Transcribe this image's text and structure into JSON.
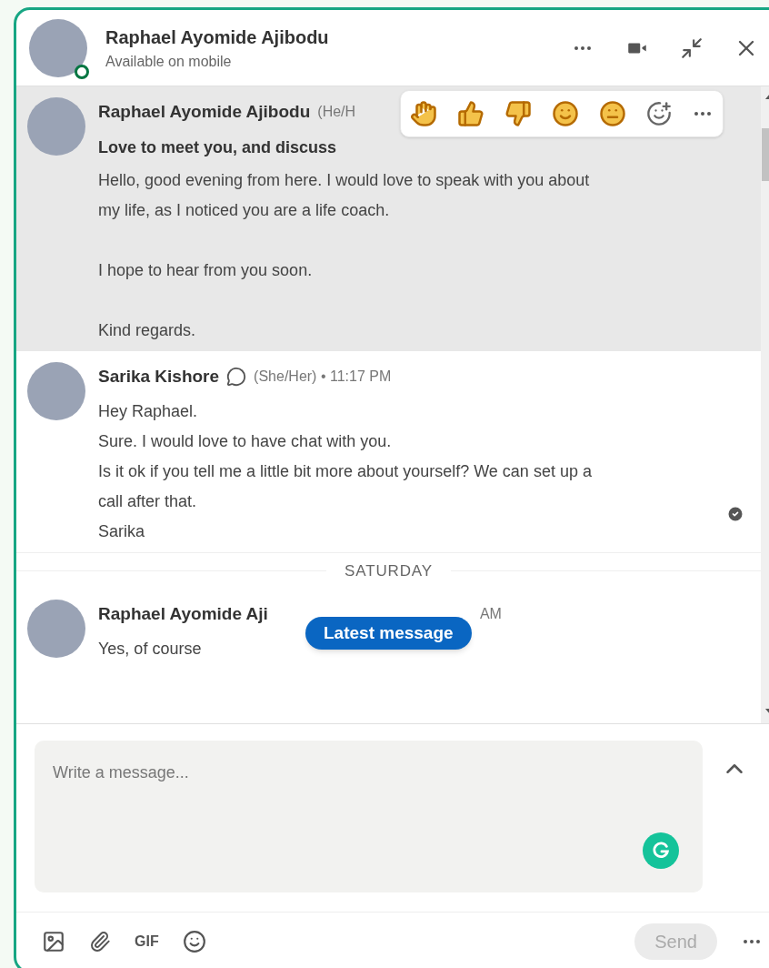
{
  "header": {
    "name": "Raphael Ayomide Ajibodu",
    "status": "Available on mobile",
    "online": true
  },
  "messages": [
    {
      "name": "Raphael Ayomide Ajibodu",
      "meta": "(He/H",
      "subject": "Love to meet you, and discuss",
      "paragraphs": [
        "Hello, good evening from here. I would love to speak with you about my life, as I noticed you are a life coach.",
        "I hope to hear from you soon.",
        "Kind regards."
      ],
      "hovered": true,
      "verified": false,
      "seen": false
    },
    {
      "name": "Sarika Kishore",
      "meta": "(She/Her) • 11:17 PM",
      "paragraphs": [
        "Hey Raphael.\nSure. I would love to have chat with you.\nIs it ok if you tell me a little bit more about yourself? We can set up a call after that.\nSarika"
      ],
      "hovered": false,
      "verified": true,
      "seen": true
    },
    {
      "kind": "divider",
      "label": "SATURDAY"
    },
    {
      "name": "Raphael Ayomide Aji",
      "meta": "AM",
      "paragraphs": [
        "Yes, of course"
      ],
      "hovered": false,
      "verified": false,
      "seen": false
    }
  ],
  "latest_button": "Latest message",
  "compose": {
    "placeholder": "Write a message..."
  },
  "toolbar": {
    "gif": "GIF",
    "send": {
      "label": "Send",
      "disabled": true
    }
  }
}
